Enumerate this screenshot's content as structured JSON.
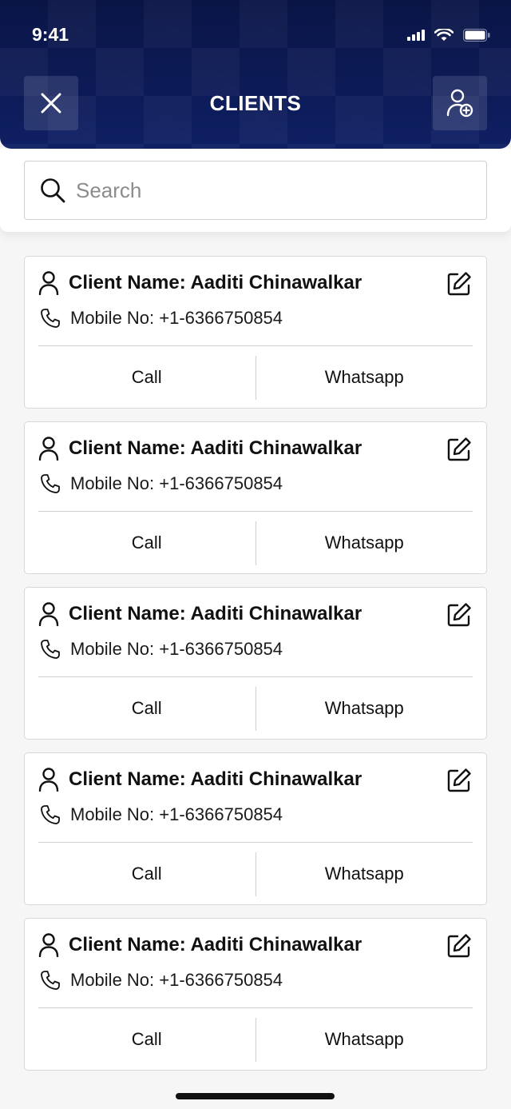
{
  "status_bar": {
    "time": "9:41"
  },
  "header": {
    "title": "CLIENTS"
  },
  "search": {
    "placeholder": "Search",
    "value": ""
  },
  "clients": [
    {
      "name_label": "Client Name: Aaditi Chinawalkar",
      "mobile_label": "Mobile No: +1-6366750854",
      "call_label": "Call",
      "whatsapp_label": "Whatsapp"
    },
    {
      "name_label": "Client Name: Aaditi Chinawalkar",
      "mobile_label": "Mobile No: +1-6366750854",
      "call_label": "Call",
      "whatsapp_label": "Whatsapp"
    },
    {
      "name_label": "Client Name: Aaditi Chinawalkar",
      "mobile_label": "Mobile No: +1-6366750854",
      "call_label": "Call",
      "whatsapp_label": "Whatsapp"
    },
    {
      "name_label": "Client Name: Aaditi Chinawalkar",
      "mobile_label": "Mobile No: +1-6366750854",
      "call_label": "Call",
      "whatsapp_label": "Whatsapp"
    },
    {
      "name_label": "Client Name: Aaditi Chinawalkar",
      "mobile_label": "Mobile No: +1-6366750854",
      "call_label": "Call",
      "whatsapp_label": "Whatsapp"
    }
  ],
  "icons": {
    "close": "close-icon",
    "add_client": "add-user-icon",
    "search": "search-icon",
    "person": "person-icon",
    "phone": "phone-icon",
    "edit": "edit-icon"
  },
  "colors": {
    "header_bg": "#0c1a55",
    "page_bg": "#f6f6f6"
  }
}
